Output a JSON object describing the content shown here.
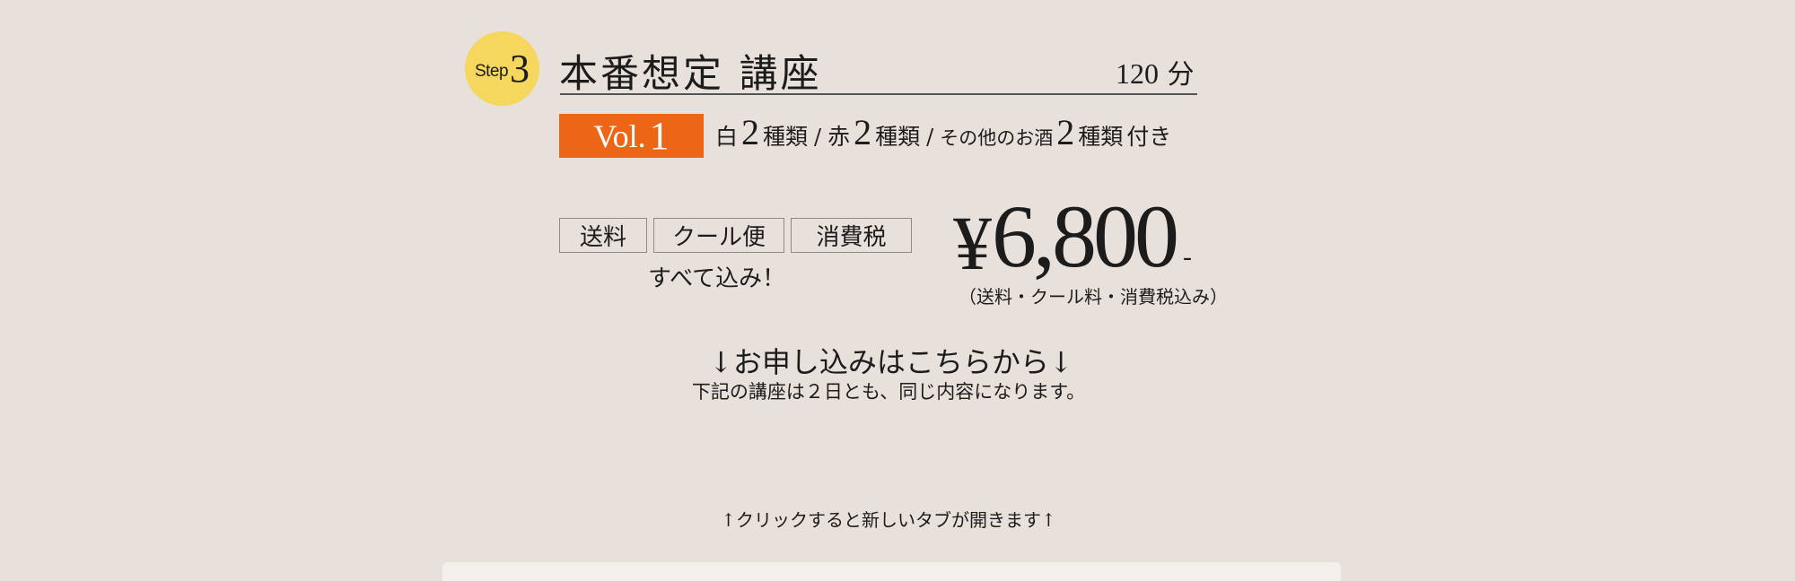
{
  "step": {
    "word": "Step",
    "number": "3"
  },
  "course": {
    "title": "本番想定 講座",
    "duration_value": "120",
    "duration_unit": "分"
  },
  "vol": {
    "prefix": "Vol.",
    "number": "1"
  },
  "wine_info": {
    "white_label": "白",
    "white_count": "2",
    "white_unit": "種類",
    "separator": "/",
    "red_label": "赤",
    "red_count": "2",
    "red_unit": "種類",
    "other_label": "その他のお酒",
    "other_count": "2",
    "other_unit": "種類",
    "suffix": "付き"
  },
  "tags": [
    "送料",
    "クール便",
    "消費税"
  ],
  "all_included": "すべて込み！",
  "price": {
    "currency": "¥",
    "amount": "6,800",
    "dash": "-",
    "note": "（送料・クール料・消費税込み）"
  },
  "apply": {
    "heading": "↓お申し込みはこちらから↓",
    "sub": "下記の講座は２日とも、同じ内容になります。"
  },
  "click_note": "↑クリックすると新しいタブが開きます↑",
  "colors": {
    "background": "#e8e0da",
    "step_badge": "#f6d75e",
    "vol_badge": "#ec6616"
  }
}
